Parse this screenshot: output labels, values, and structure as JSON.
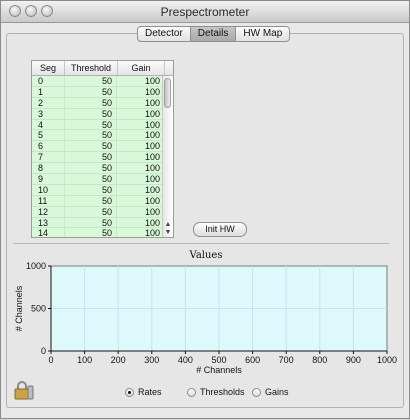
{
  "window": {
    "title": "Prespectrometer"
  },
  "tabs": [
    {
      "label": "Detector",
      "active": false
    },
    {
      "label": "Details",
      "active": true
    },
    {
      "label": "HW Map",
      "active": false
    }
  ],
  "table": {
    "columns": [
      "Seg",
      "Threshold",
      "Gain"
    ],
    "rows": [
      [
        "0",
        "50",
        "100"
      ],
      [
        "1",
        "50",
        "100"
      ],
      [
        "2",
        "50",
        "100"
      ],
      [
        "3",
        "50",
        "100"
      ],
      [
        "4",
        "50",
        "100"
      ],
      [
        "5",
        "50",
        "100"
      ],
      [
        "6",
        "50",
        "100"
      ],
      [
        "7",
        "50",
        "100"
      ],
      [
        "8",
        "50",
        "100"
      ],
      [
        "9",
        "50",
        "100"
      ],
      [
        "10",
        "50",
        "100"
      ],
      [
        "11",
        "50",
        "100"
      ],
      [
        "12",
        "50",
        "100"
      ],
      [
        "13",
        "50",
        "100"
      ],
      [
        "14",
        "50",
        "100"
      ]
    ]
  },
  "buttons": {
    "init_hw": "Init HW"
  },
  "chart_data": {
    "type": "line",
    "title": "Values",
    "xlabel": "# Channels",
    "ylabel": "# Channels",
    "xlim": [
      0,
      1000
    ],
    "ylim": [
      0,
      1000
    ],
    "x_ticks": [
      0,
      100,
      200,
      300,
      400,
      500,
      600,
      700,
      800,
      900,
      1000
    ],
    "y_ticks": [
      0,
      500,
      1000
    ],
    "grid": true,
    "series": []
  },
  "radio": {
    "options": [
      {
        "label": "Rates",
        "selected": true
      },
      {
        "label": "Thresholds",
        "selected": false
      },
      {
        "label": "Gains",
        "selected": false
      }
    ]
  },
  "colors": {
    "table_row_bg": "#d9f7d9",
    "plot_bg": "#ddf9fb"
  }
}
